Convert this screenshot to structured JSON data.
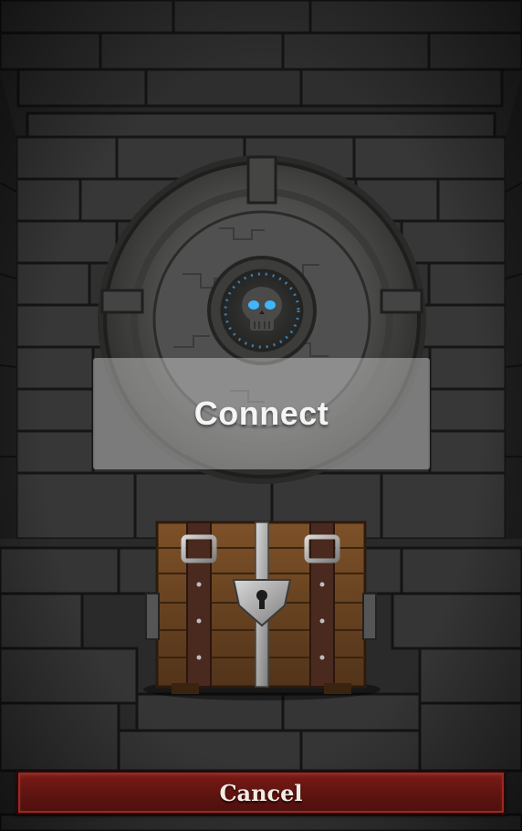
{
  "dialog": {
    "connect_label": "Connect",
    "cancel_label": "Cancel"
  },
  "colors": {
    "stone_dark": "#1e1e1e",
    "stone_mid": "#3a3a3a",
    "wood": "#6b4423",
    "leather": "#4a2a1e",
    "skull_eyes": "#3fb6ff",
    "cancel_red": "#6a1713"
  },
  "scene": {
    "wall_seal_icon": "skull-seal-icon",
    "chest_icon": "treasure-chest-icon",
    "lock_icon": "keyhole-lock-icon"
  }
}
